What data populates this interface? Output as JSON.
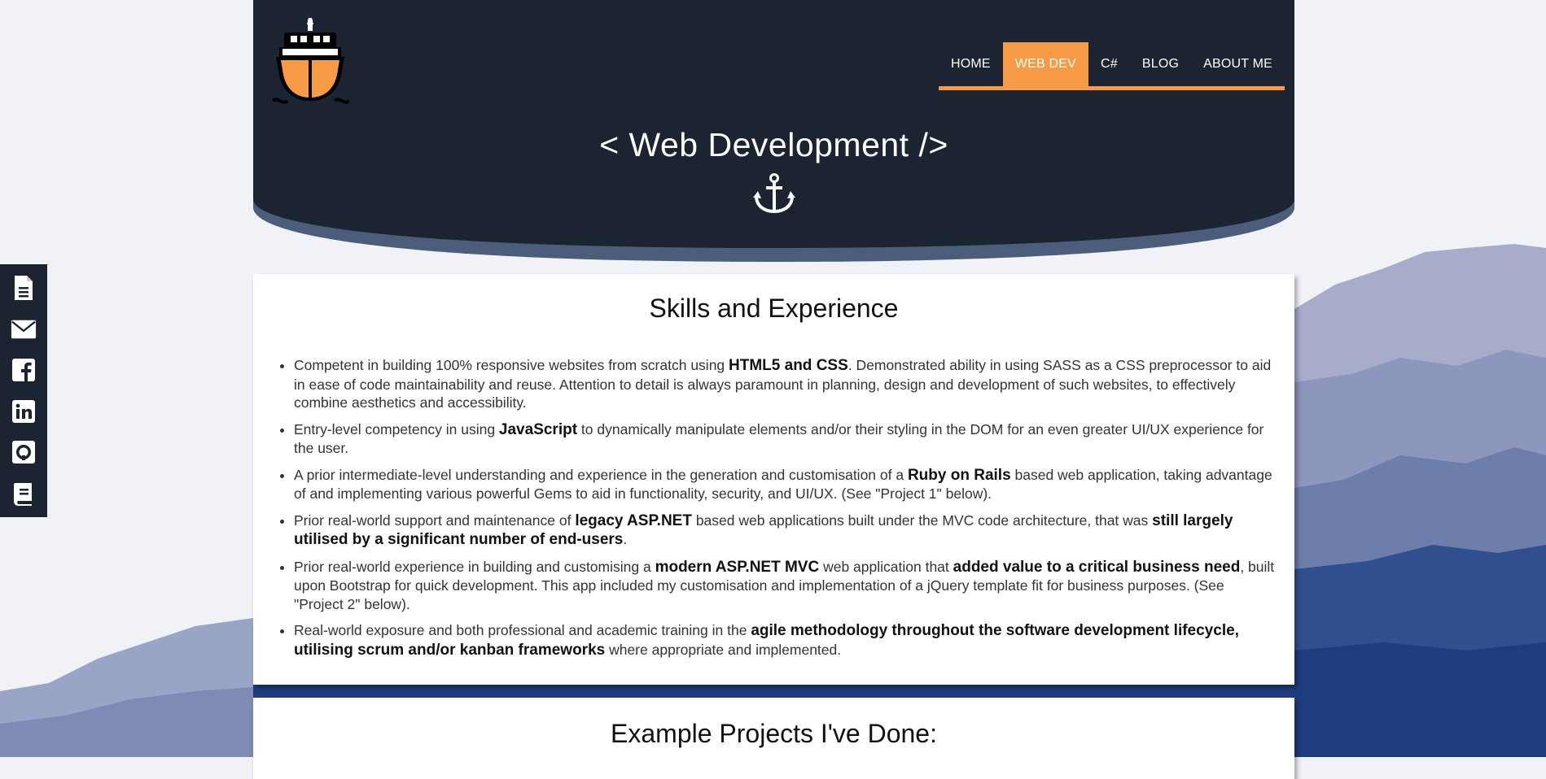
{
  "sidebar": {
    "icons": [
      "document-icon",
      "mail-icon",
      "facebook-icon",
      "linkedin-icon",
      "github-icon",
      "book-icon"
    ]
  },
  "nav": {
    "items": [
      {
        "label": "HOME",
        "active": false
      },
      {
        "label": "WEB DEV",
        "active": true
      },
      {
        "label": "C#",
        "active": false
      },
      {
        "label": "BLOG",
        "active": false
      },
      {
        "label": "ABOUT ME",
        "active": false
      }
    ]
  },
  "hero": {
    "title": "< Web Development />"
  },
  "skills": {
    "heading": "Skills and Experience",
    "items": [
      [
        {
          "t": "Competent in building 100% responsive websites from scratch using "
        },
        {
          "t": "HTML5 and CSS",
          "b": true
        },
        {
          "t": ". Demonstrated ability in using SASS as a CSS preprocessor to aid in ease of code maintainability and reuse. Attention to detail is always paramount in planning, design and development of such websites, to effectively combine aesthetics and accessibility."
        }
      ],
      [
        {
          "t": "Entry-level competency in using "
        },
        {
          "t": "JavaScript",
          "b": true
        },
        {
          "t": " to dynamically manipulate elements and/or their styling in the DOM for an even greater UI/UX experience for the user."
        }
      ],
      [
        {
          "t": "A prior intermediate-level understanding and experience in the generation and customisation of a "
        },
        {
          "t": "Ruby on Rails",
          "b": true
        },
        {
          "t": " based web application, taking advantage of and implementing various powerful Gems to aid in functionality, security, and UI/UX. (See \"Project 1\" below)."
        }
      ],
      [
        {
          "t": "Prior real-world support and maintenance of "
        },
        {
          "t": "legacy ASP.NET",
          "b": true
        },
        {
          "t": " based web applications built under the MVC code architecture, that was "
        },
        {
          "t": "still largely utilised by a significant number of end-users",
          "b": true
        },
        {
          "t": "."
        }
      ],
      [
        {
          "t": "Prior real-world experience in building and customising a "
        },
        {
          "t": "modern ASP.NET MVC",
          "b": true
        },
        {
          "t": " web application that "
        },
        {
          "t": "added value to a critical business need",
          "b": true
        },
        {
          "t": ", built upon Bootstrap for quick development. This app included my customisation and implementation of a jQuery template fit for business purposes. (See \"Project 2\" below)."
        }
      ],
      [
        {
          "t": "Real-world exposure and both professional and academic training in the "
        },
        {
          "t": "agile methodology throughout the software development lifecycle, utilising scrum and/or kanban frameworks",
          "b": true
        },
        {
          "t": " where appropriate and implemented."
        }
      ]
    ]
  },
  "projects": {
    "heading": "Example Projects I've Done:"
  },
  "colors": {
    "header_bg": "#1b2430",
    "accent": "#f79a45",
    "header_curve": "#4b5d7a",
    "page_bg": "#f1f2f7"
  }
}
